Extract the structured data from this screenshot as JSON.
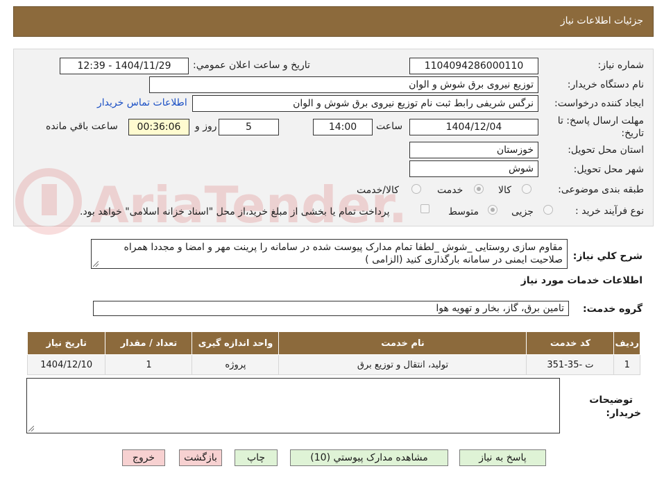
{
  "header": {
    "title": "جزئیات اطلاعات نیاز"
  },
  "form": {
    "need_number_label": "شماره نیاز:",
    "need_number": "1104094286000110",
    "announce_label": "تاریخ و ساعت اعلان عمومي:",
    "announce_value": "1404/11/29 - 12:39",
    "buyer_org_label": "نام دستگاه خریدار:",
    "buyer_org": "توزیع نیروی برق شوش و الوان",
    "creator_label": "ایجاد کننده درخواست:",
    "creator": "نرگس شریفی رابط ثبت نام توزیع نیروی برق شوش و الوان",
    "contact_link": "اطلاعات تماس خریدار",
    "deadline_label_1": "مهلت ارسال پاسخ: تا",
    "deadline_label_2": "تاریخ:",
    "deadline_date": "1404/12/04",
    "time_label": "ساعت",
    "deadline_time": "14:00",
    "days": "5",
    "days_label": "روز و",
    "remaining_time": "00:36:06",
    "remaining_label": "ساعت باقي مانده",
    "province_label": "استان محل تحویل:",
    "province": "خوزستان",
    "city_label": "شهر محل تحویل:",
    "city": "شوش",
    "category_label": "طبقه بندی موضوعی:",
    "category_options": [
      "کالا",
      "خدمت",
      "کالا/خدمت"
    ],
    "process_label": "نوع فرآیند خرید :",
    "process_options": [
      "جزیی",
      "متوسط"
    ],
    "payment_note": "پرداخت تمام یا بخشی از مبلغ خرید،از محل \"اسناد خزانه اسلامی\" خواهد بود.",
    "description_label": "شرح كلي نیاز:",
    "description": "مقاوم سازی روستایی _شوش _لطفا تمام مدارک پیوست شده در سامانه را پرینت مهر و امضا و مجددا همراه صلاحیت ایمنی در سامانه بارگذاری کنید (الزامی )"
  },
  "services": {
    "section_title": "اطلاعات خدمات مورد نیاز",
    "group_label": "گروه خدمت:",
    "group_value": "تامین برق، گاز، بخار و تهویه هوا",
    "columns": [
      "ردیف",
      "کد خدمت",
      "نام خدمت",
      "واحد اندازه گیری",
      "تعداد / مقدار",
      "تاریخ نیاز"
    ],
    "rows": [
      [
        "1",
        "ت -35-351",
        "تولید، انتقال و توزیع برق",
        "پروژه",
        "1",
        "1404/12/10"
      ]
    ]
  },
  "buyer_notes": {
    "label_1": "توضیحات",
    "label_2": "خریدار:",
    "value": ""
  },
  "buttons": {
    "reply": "پاسخ به نیاز",
    "attachments": "مشاهده مدارک پیوستي (10)",
    "print": "چاپ",
    "back": "بازگشت",
    "exit": "خروج"
  },
  "watermark": {
    "text": "AriaTender.neT"
  },
  "colors": {
    "header": "#8c6a3c",
    "link": "#1a4fc4",
    "button_green": "#dff3d6",
    "button_pink": "#f7d1d1"
  }
}
